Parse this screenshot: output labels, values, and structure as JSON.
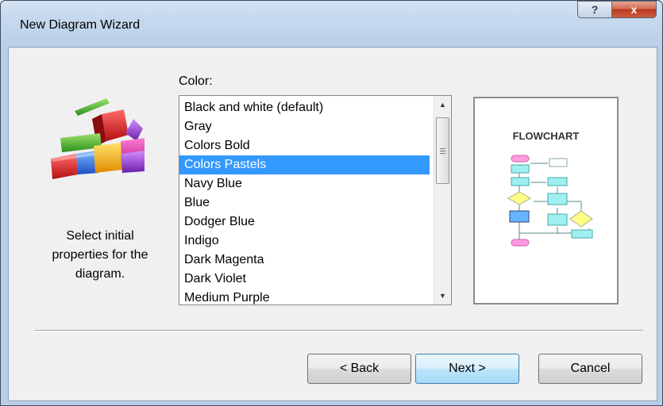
{
  "window": {
    "title": "New Diagram Wizard",
    "help_symbol": "?",
    "close_symbol": "x"
  },
  "left_panel": {
    "description": "Select initial properties for the diagram."
  },
  "color": {
    "label": "Color:",
    "options": [
      "Black and white (default)",
      "Gray",
      "Colors Bold",
      "Colors Pastels",
      "Navy Blue",
      "Blue",
      "Dodger Blue",
      "Indigo",
      "Dark Magenta",
      "Dark Violet",
      "Medium Purple"
    ],
    "selected": "Colors Pastels",
    "selected_color": "#3399ff"
  },
  "preview": {
    "title": "FLOWCHART"
  },
  "buttons": {
    "back": "< Back",
    "next": "Next >",
    "cancel": "Cancel"
  },
  "icons": {
    "help": "question-icon",
    "close": "close-icon",
    "wizard": "colored-blocks-icon",
    "scroll_up": "arrow-up-icon",
    "scroll_down": "arrow-down-icon"
  }
}
